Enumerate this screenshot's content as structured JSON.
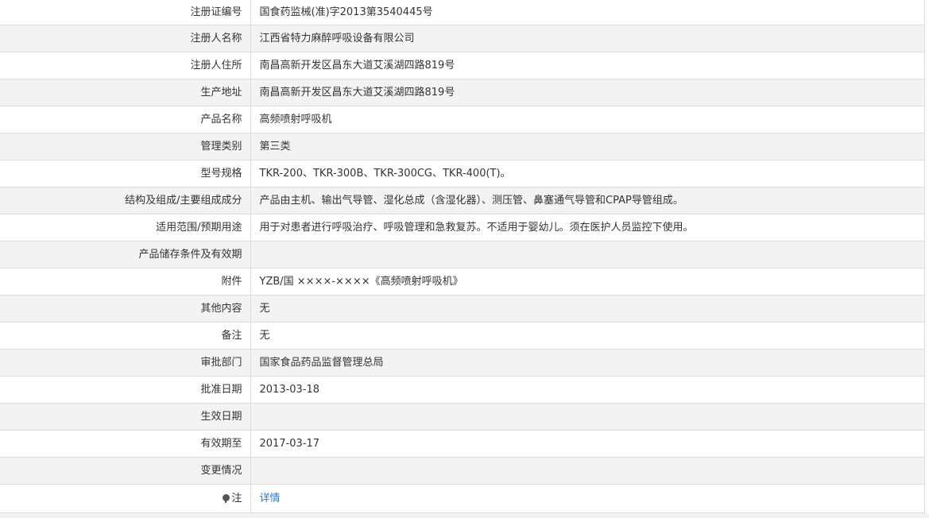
{
  "rows": [
    {
      "label": "注册证编号",
      "value": "国食药监械(准)字2013第3540445号"
    },
    {
      "label": "注册人名称",
      "value": "江西省特力麻醉呼吸设备有限公司"
    },
    {
      "label": "注册人住所",
      "value": "南昌高新开发区昌东大道艾溪湖四路819号"
    },
    {
      "label": "生产地址",
      "value": "南昌高新开发区昌东大道艾溪湖四路819号"
    },
    {
      "label": "产品名称",
      "value": "高频喷射呼吸机"
    },
    {
      "label": "管理类别",
      "value": "第三类"
    },
    {
      "label": "型号规格",
      "value": "TKR-200、TKR-300B、TKR-300CG、TKR-400(T)。"
    },
    {
      "label": "结构及组成/主要组成成分",
      "value": "产品由主机、输出气导管、湿化总成（含湿化器）、测压管、鼻塞通气导管和CPAP导管组成。"
    },
    {
      "label": "适用范围/预期用途",
      "value": "用于对患者进行呼吸治疗、呼吸管理和急救复苏。不适用于婴幼儿。须在医护人员监控下使用。"
    },
    {
      "label": "产品储存条件及有效期",
      "value": ""
    },
    {
      "label": "附件",
      "value": "YZB/国 ××××-××××《高频喷射呼吸机》"
    },
    {
      "label": "其他内容",
      "value": "无"
    },
    {
      "label": "备注",
      "value": "无"
    },
    {
      "label": "审批部门",
      "value": "国家食品药品监督管理总局"
    },
    {
      "label": "批准日期",
      "value": "2013-03-18"
    },
    {
      "label": "生效日期",
      "value": ""
    },
    {
      "label": "有效期至",
      "value": "2017-03-17"
    },
    {
      "label": "变更情况",
      "value": ""
    }
  ],
  "note": {
    "icon": "pin-icon",
    "label": "注",
    "link_text": "详情"
  },
  "colors": {
    "row_alt_bg": "#f3f3f3",
    "border": "#dddddd",
    "text": "#333333",
    "link": "#2a7bc8"
  }
}
